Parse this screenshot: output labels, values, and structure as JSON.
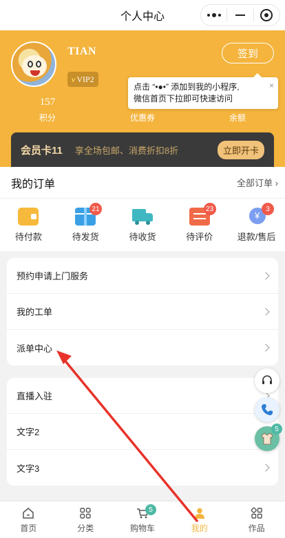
{
  "navbar": {
    "title": "个人中心"
  },
  "profile": {
    "username": "TIAN",
    "vip_prefix": "v",
    "vip_label": "VIP2",
    "signin_label": "签到",
    "stats": [
      {
        "num": "157",
        "label": "积分"
      },
      {
        "num": "",
        "label": "优惠券"
      },
      {
        "num": "",
        "label": "余额"
      }
    ]
  },
  "tooltip": {
    "line1": "点击 “•●•” 添加到我的小程序,",
    "line2": "微信首页下拉即可快速访问",
    "close": "×"
  },
  "member": {
    "name": "会员卡11",
    "desc": "享全场包邮、消费折扣8折",
    "button": "立即开卡"
  },
  "orders": {
    "title": "我的订单",
    "all_label": "全部订单",
    "items": [
      {
        "label": "待付款",
        "badge": ""
      },
      {
        "label": "待发货",
        "badge": "21"
      },
      {
        "label": "待收货",
        "badge": ""
      },
      {
        "label": "待评价",
        "badge": "23"
      },
      {
        "label": "退款/售后",
        "badge": "3"
      }
    ]
  },
  "menu1": [
    "预约申请上门服务",
    "我的工单",
    "派单中心"
  ],
  "menu2": [
    "直播入驻",
    "文字2",
    "文字3"
  ],
  "floating": {
    "gallery_badge": "5"
  },
  "tabbar": {
    "items": [
      {
        "label": "首页"
      },
      {
        "label": "分类"
      },
      {
        "label": "购物车",
        "badge": "5"
      },
      {
        "label": "我的"
      },
      {
        "label": "作品"
      }
    ]
  },
  "colors": {
    "accent": "#f4b43d",
    "badge_red": "#f05a4a",
    "badge_teal": "#4fb9a6",
    "annotation_arrow": "#e8332a"
  }
}
